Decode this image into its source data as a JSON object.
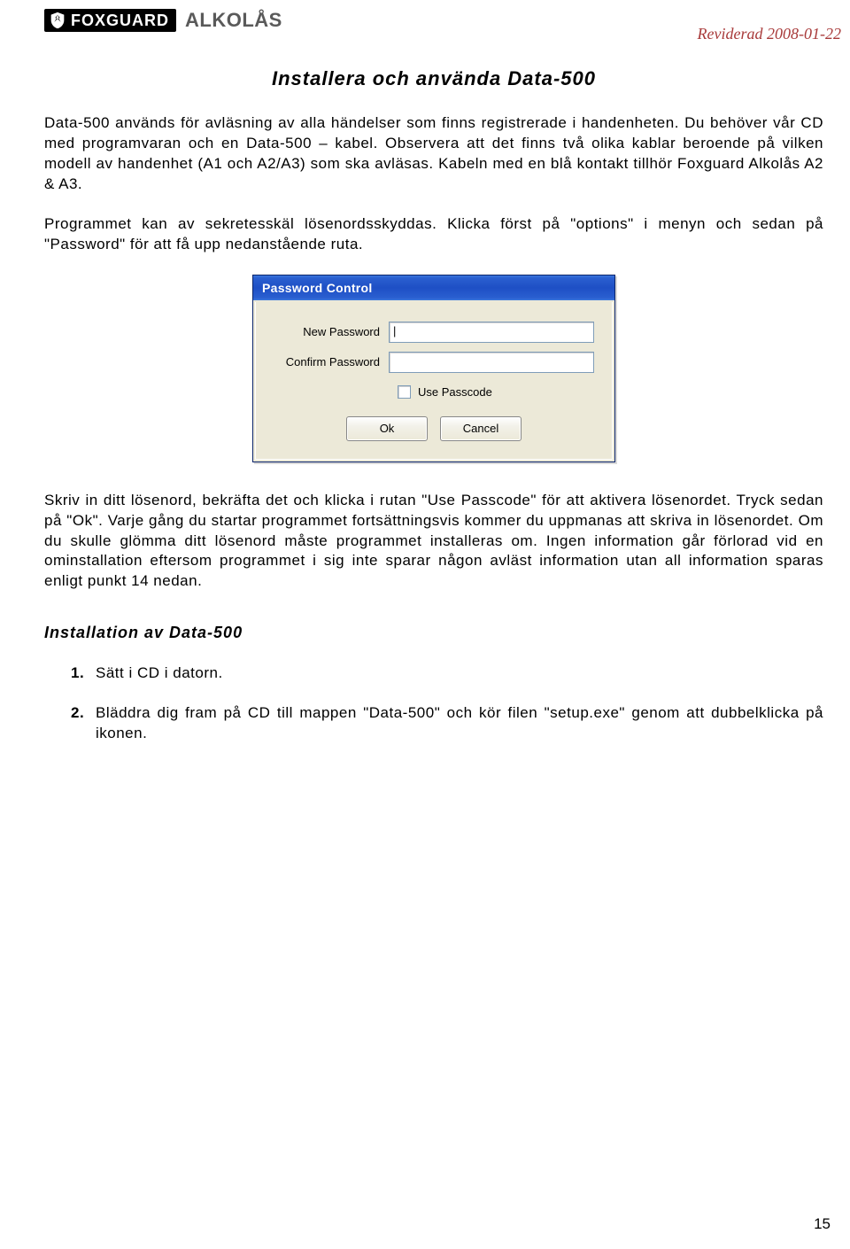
{
  "header": {
    "brand_primary": "FOXGUARD",
    "brand_secondary": "ALKOLÅS",
    "revision": "Reviderad 2008-01-22"
  },
  "title": "Installera och använda Data-500",
  "para1": "Data-500 används för avläsning av alla händelser som finns registrerade i handenheten. Du behöver vår CD med programvaran och en Data-500 – kabel. Observera att det finns två olika kablar beroende på vilken modell av handenhet (A1 och A2/A3) som ska avläsas. Kabeln med en blå kontakt tillhör Foxguard Alkolås A2 & A3.",
  "para2": "Programmet kan av sekretesskäl lösenordsskyddas. Klicka först på \"options\" i menyn och sedan på \"Password\" för att få upp nedanstående ruta.",
  "dialog": {
    "title": "Password Control",
    "new_password_label": "New Password",
    "confirm_password_label": "Confirm Password",
    "new_password_value": "|",
    "confirm_password_value": "",
    "use_passcode_label": "Use Passcode",
    "ok_label": "Ok",
    "cancel_label": "Cancel"
  },
  "para3": "Skriv in ditt lösenord, bekräfta det och klicka i rutan \"Use Passcode\" för att aktivera lösenordet. Tryck sedan på \"Ok\". Varje gång du startar programmet fortsättningsvis kommer du uppmanas att skriva in lösenordet. Om du skulle glömma ditt lösenord måste programmet installeras om. Ingen information går förlorad vid en ominstallation eftersom programmet i sig inte sparar någon avläst information utan all information sparas enligt punkt 14 nedan.",
  "subheading": "Installation av Data-500",
  "steps": [
    {
      "num": "1.",
      "text": "Sätt i CD i datorn."
    },
    {
      "num": "2.",
      "text": "Bläddra dig fram på CD till mappen \"Data-500\" och kör filen \"setup.exe\" genom att dubbelklicka på ikonen."
    }
  ],
  "page_number": "15"
}
